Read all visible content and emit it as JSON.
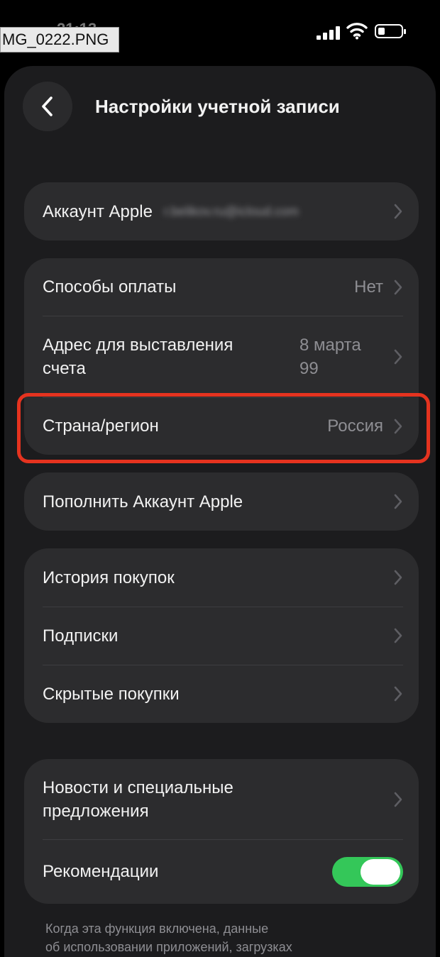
{
  "status_bar": {
    "filename_tag": "MG_0222.PNG",
    "time": "21:13"
  },
  "header": {
    "title": "Настройки учетной записи"
  },
  "account_group": {
    "label": "Аккаунт Apple",
    "value": "r.belikov.ru@icloud.com"
  },
  "payment_group": {
    "payment_methods": {
      "label": "Способы оплаты",
      "value": "Нет"
    },
    "billing_address": {
      "label_line1": "Адрес для выставления",
      "label_line2": "счета",
      "value_line1": "8 марта",
      "value_line2": "99"
    },
    "country_region": {
      "label": "Страна/регион",
      "value": "Россия"
    }
  },
  "topup_group": {
    "label": "Пополнить Аккаунт Apple"
  },
  "history_group": {
    "items": [
      {
        "label": "История покупок"
      },
      {
        "label": "Подписки"
      },
      {
        "label": "Скрытые покупки"
      }
    ]
  },
  "news_group": {
    "news": {
      "label_line1": "Новости и специальные",
      "label_line2": "предложения"
    },
    "recommendations": {
      "label": "Рекомендации",
      "enabled": true
    }
  },
  "footnote": {
    "line1": "Когда эта функция включена, данные",
    "line2": "об использовании приложений, загрузках"
  },
  "colors": {
    "sheet": "#1c1c1e",
    "cell": "#2c2c2e",
    "secondary_text": "#8e8e93",
    "toggle_on": "#34c759",
    "highlight": "#e5331f"
  }
}
